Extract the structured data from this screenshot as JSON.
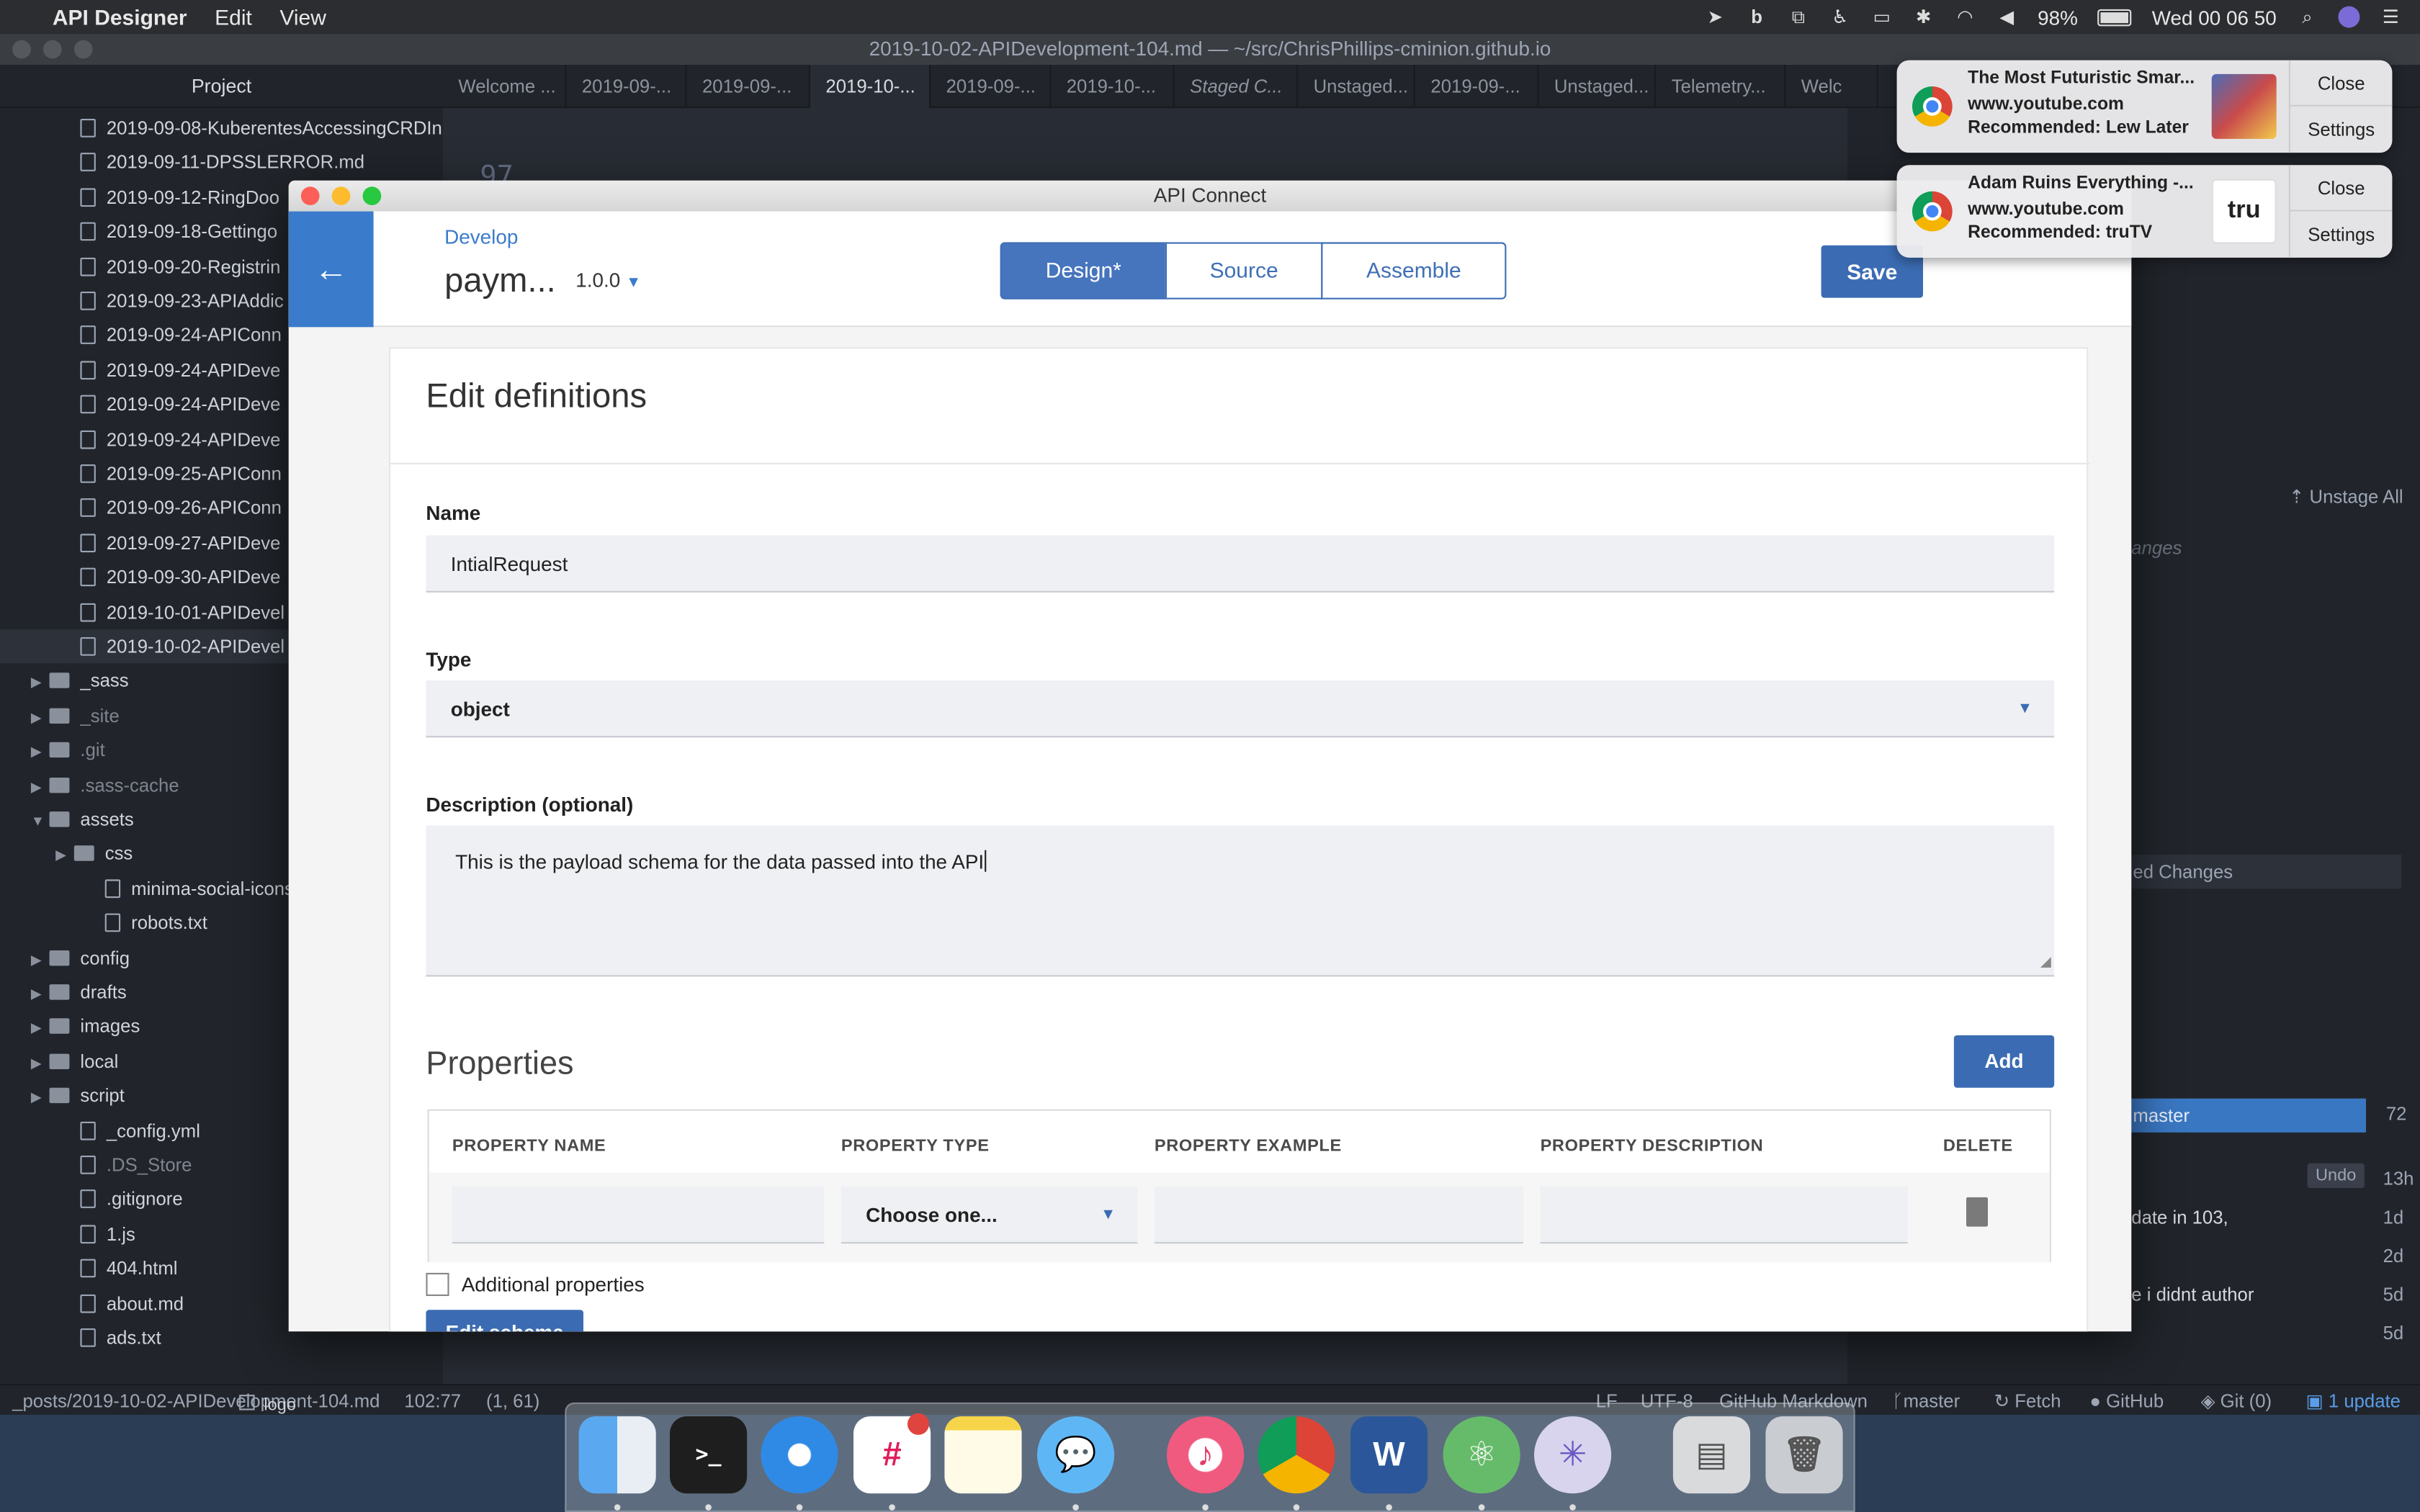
{
  "menubar": {
    "app": "API Designer",
    "edit": "Edit",
    "view": "View",
    "battery": "98%",
    "clock": "Wed 00 06 50"
  },
  "atom": {
    "title": "2019-10-02-APIDevelopment-104.md — ~/src/ChrisPhillips-cminion.github.io",
    "project_label": "Project",
    "tabs": [
      "Welcome ...",
      "2019-09-...",
      "2019-09-...",
      "2019-10-...",
      "2019-09-...",
      "2019-10-...",
      "Staged C...",
      "Unstaged...",
      "2019-09-...",
      "Unstaged...",
      "Telemetry...",
      "Welc"
    ],
    "tree": [
      {
        "label": "2019-09-08-KuberentesAccessingCRDIn",
        "kind": "file"
      },
      {
        "label": "2019-09-11-DPSSLERROR.md",
        "kind": "file"
      },
      {
        "label": "2019-09-12-RingDoo",
        "kind": "file"
      },
      {
        "label": "2019-09-18-Gettingo",
        "kind": "file"
      },
      {
        "label": "2019-09-20-Registrin",
        "kind": "file"
      },
      {
        "label": "2019-09-23-APIAddic",
        "kind": "file"
      },
      {
        "label": "2019-09-24-APIConn",
        "kind": "file"
      },
      {
        "label": "2019-09-24-APIDeve",
        "kind": "file"
      },
      {
        "label": "2019-09-24-APIDeve",
        "kind": "file"
      },
      {
        "label": "2019-09-24-APIDeve",
        "kind": "file"
      },
      {
        "label": "2019-09-25-APIConn",
        "kind": "file"
      },
      {
        "label": "2019-09-26-APIConn",
        "kind": "file"
      },
      {
        "label": "2019-09-27-APIDeve",
        "kind": "file"
      },
      {
        "label": "2019-09-30-APIDeve",
        "kind": "file"
      },
      {
        "label": "2019-10-01-APIDevel",
        "kind": "file"
      },
      {
        "label": "2019-10-02-APIDevel",
        "kind": "file",
        "selected": true
      },
      {
        "label": "_sass",
        "kind": "folder"
      },
      {
        "label": "_site",
        "kind": "folder",
        "dim": true
      },
      {
        "label": ".git",
        "kind": "folder",
        "dim": true
      },
      {
        "label": ".sass-cache",
        "kind": "folder",
        "dim": true
      },
      {
        "label": "assets",
        "kind": "folder",
        "open": true
      },
      {
        "label": "css",
        "kind": "folder",
        "indent": 1
      },
      {
        "label": "minima-social-icons.s",
        "kind": "file",
        "indent": 1
      },
      {
        "label": "robots.txt",
        "kind": "file",
        "indent": 1
      },
      {
        "label": "config",
        "kind": "folder"
      },
      {
        "label": "drafts",
        "kind": "folder"
      },
      {
        "label": "images",
        "kind": "folder"
      },
      {
        "label": "local",
        "kind": "folder"
      },
      {
        "label": "script",
        "kind": "folder"
      },
      {
        "label": "_config.yml",
        "kind": "file"
      },
      {
        "label": ".DS_Store",
        "kind": "file",
        "dim": true
      },
      {
        "label": ".gitignore",
        "kind": "file"
      },
      {
        "label": "1.js",
        "kind": "file"
      },
      {
        "label": "404.html",
        "kind": "file"
      },
      {
        "label": "about.md",
        "kind": "file"
      },
      {
        "label": "ads.txt",
        "kind": "file"
      }
    ],
    "bottom_item": "logo",
    "editor_line_number": "97",
    "git": {
      "unstage_all": "Unstage All",
      "unstaged_changes": "anges",
      "staged_changes": "ed Changes",
      "branch": "master",
      "commit_count": "72",
      "undo": "Undo",
      "commits": [
        {
          "msg": "",
          "age": "13h"
        },
        {
          "msg": "date in 103,",
          "age": "1d"
        },
        {
          "msg": "",
          "age": "2d"
        },
        {
          "msg": "e i didnt author",
          "age": "5d"
        },
        {
          "msg": "",
          "age": "5d"
        }
      ]
    },
    "status": {
      "path": "_posts/2019-10-02-APIDevelopment-104.md",
      "cursor": "102:77",
      "selection": "(1, 61)",
      "eol": "LF",
      "encoding": "UTF-8",
      "grammar": "GitHub Markdown",
      "branch": "master",
      "fetch": "Fetch",
      "github": "GitHub",
      "git": "Git (0)",
      "update": "1 update"
    }
  },
  "apic": {
    "window_title": "API Connect",
    "breadcrumb": "Develop",
    "api_name": "paym...",
    "version": "1.0.0",
    "tabs": {
      "design": "Design*",
      "source": "Source",
      "assemble": "Assemble"
    },
    "save": "Save",
    "section_title": "Edit definitions",
    "name_label": "Name",
    "name_value": "IntialRequest",
    "type_label": "Type",
    "type_value": "object",
    "desc_label": "Description (optional)",
    "desc_value": "This is the payload schema for the data passed into  the API",
    "properties_title": "Properties",
    "add": "Add",
    "columns": {
      "name": "PROPERTY NAME",
      "type": "PROPERTY TYPE",
      "example": "PROPERTY EXAMPLE",
      "description": "PROPERTY DESCRIPTION",
      "delete": "DELETE"
    },
    "row_type_placeholder": "Choose one...",
    "additional_properties": "Additional properties",
    "edit_schema": "Edit schema"
  },
  "notifications": [
    {
      "title": "The Most Futuristic Smar...",
      "source": "www.youtube.com",
      "reason": "Recommended: Lew Later",
      "close": "Close",
      "settings": "Settings"
    },
    {
      "title": "Adam Ruins Everything -...",
      "source": "www.youtube.com",
      "reason": "Recommended: truTV",
      "close": "Close",
      "settings": "Settings",
      "thumb_text": "tru"
    }
  ],
  "dock": [
    "Finder",
    "Terminal",
    "Safari",
    "Slack",
    "Notes",
    "Messages",
    "iTunes",
    "Chrome",
    "Word",
    "Atom",
    "API Designer",
    "Printer",
    "Trash"
  ],
  "colors": {
    "accent": "#3b6cb3",
    "menubar": "#2c2d30",
    "atom_bg": "#21252b"
  }
}
